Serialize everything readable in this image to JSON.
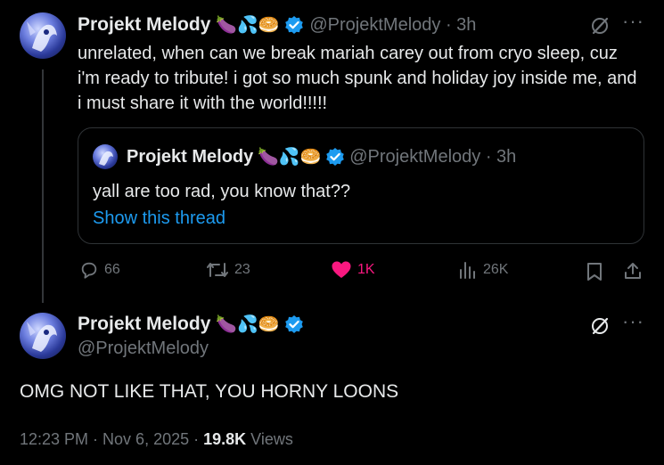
{
  "tweet1": {
    "display_name": "Projekt Melody",
    "name_emojis": "🍆💦🥯",
    "handle_time": "@ProjektMelody · 3h",
    "text": "unrelated, when can we break mariah carey out from cryo sleep, cuz i'm ready to tribute! i got so much spunk and holiday joy inside me, and i must share it with the world!!!!!",
    "quote": {
      "display_name": "Projekt Melody",
      "name_emojis": "🍆💦🥯",
      "handle_time": "@ProjektMelody · 3h",
      "text": "yall are too rad, you know that??",
      "show_thread": "Show this thread"
    },
    "actions": {
      "replies": "66",
      "retweets": "23",
      "likes": "1K",
      "views": "26K"
    }
  },
  "tweet2": {
    "display_name": "Projekt Melody",
    "name_emojis": "🍆💦🥯",
    "handle": "@ProjektMelody",
    "text": "OMG NOT LIKE THAT, YOU HORNY LOONS",
    "timestamp": "12:23 PM · Nov 6, 2025 · ",
    "views_count": "19.8K",
    "views_label": " Views"
  },
  "colors": {
    "background": "#000000",
    "text": "#e7e9ea",
    "muted": "#71767b",
    "link": "#1d9bf0",
    "like": "#f91880",
    "verified": "#1d9bf0"
  }
}
